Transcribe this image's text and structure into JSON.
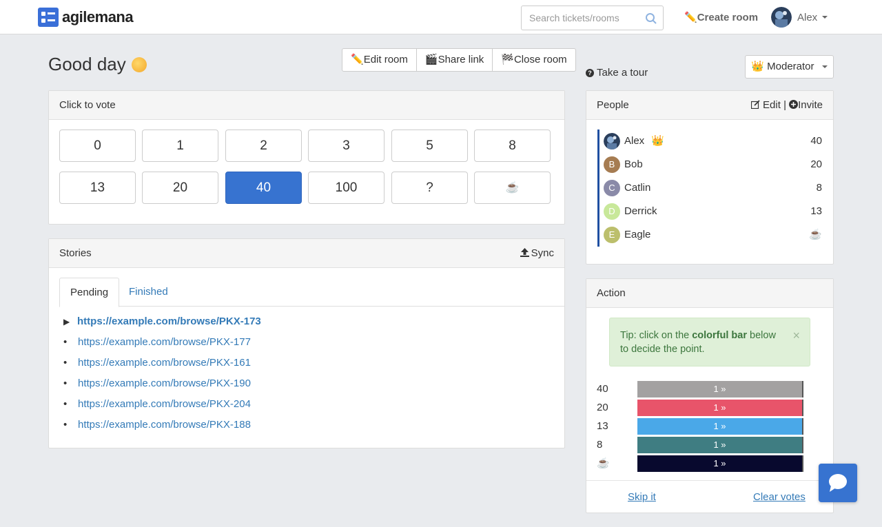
{
  "brand": {
    "name": "agilemana"
  },
  "nav": {
    "search_placeholder": "Search tickets/rooms",
    "create_room": "Create room",
    "user_name": "Alex",
    "pencil": "✏️"
  },
  "heading": {
    "greeting": "Good day",
    "actions": [
      {
        "icon": "✏️",
        "label": "Edit room"
      },
      {
        "icon": "🎬",
        "label": "Share link"
      },
      {
        "icon": "🏁",
        "label": "Close room"
      }
    ]
  },
  "tour": {
    "label": "Take a tour",
    "q": "?"
  },
  "role": {
    "icon": "👑",
    "label": "Moderator"
  },
  "vote_panel": {
    "title": "Click to vote",
    "selected": "40",
    "cards": [
      "0",
      "1",
      "2",
      "3",
      "5",
      "8",
      "13",
      "20",
      "40",
      "100",
      "?",
      "☕"
    ]
  },
  "stories": {
    "title": "Stories",
    "sync_label": "Sync",
    "tabs": [
      "Pending",
      "Finished"
    ],
    "current_marker": "▶",
    "bullet": "•",
    "items": [
      "https://example.com/browse/PKX-173",
      "https://example.com/browse/PKX-177",
      "https://example.com/browse/PKX-161",
      "https://example.com/browse/PKX-190",
      "https://example.com/browse/PKX-204",
      "https://example.com/browse/PKX-188"
    ]
  },
  "people": {
    "title": "People",
    "edit_label": "Edit",
    "separator": "|",
    "invite_label": "Invite",
    "members": [
      {
        "name": "Alex",
        "initial": "",
        "badge": "👑",
        "vote": "40",
        "color": "#2b3f5c"
      },
      {
        "name": "Bob",
        "initial": "B",
        "badge": "",
        "vote": "20",
        "color": "#a67c52"
      },
      {
        "name": "Catlin",
        "initial": "C",
        "badge": "",
        "vote": "8",
        "color": "#8a8aa8"
      },
      {
        "name": "Derrick",
        "initial": "D",
        "badge": "",
        "vote": "13",
        "color": "#c8e89a"
      },
      {
        "name": "Eagle",
        "initial": "E",
        "badge": "",
        "vote": "☕",
        "color": "#bcbf6c"
      }
    ]
  },
  "action": {
    "title": "Action",
    "tip_prefix": "Tip: click on the ",
    "tip_bold": "colorful bar",
    "tip_suffix": " below to decide the point.",
    "close": "×",
    "results": [
      {
        "label": "40",
        "count": "1 »",
        "color": "#a3a1a1"
      },
      {
        "label": "20",
        "count": "1 »",
        "color": "#e8546a"
      },
      {
        "label": "13",
        "count": "1 »",
        "color": "#4aa8e8"
      },
      {
        "label": "8",
        "count": "1 »",
        "color": "#3f7d82"
      },
      {
        "label": "☕",
        "count": "1 »",
        "color": "#08092e"
      }
    ],
    "skip_label": "Skip it",
    "clear_label": "Clear votes"
  }
}
